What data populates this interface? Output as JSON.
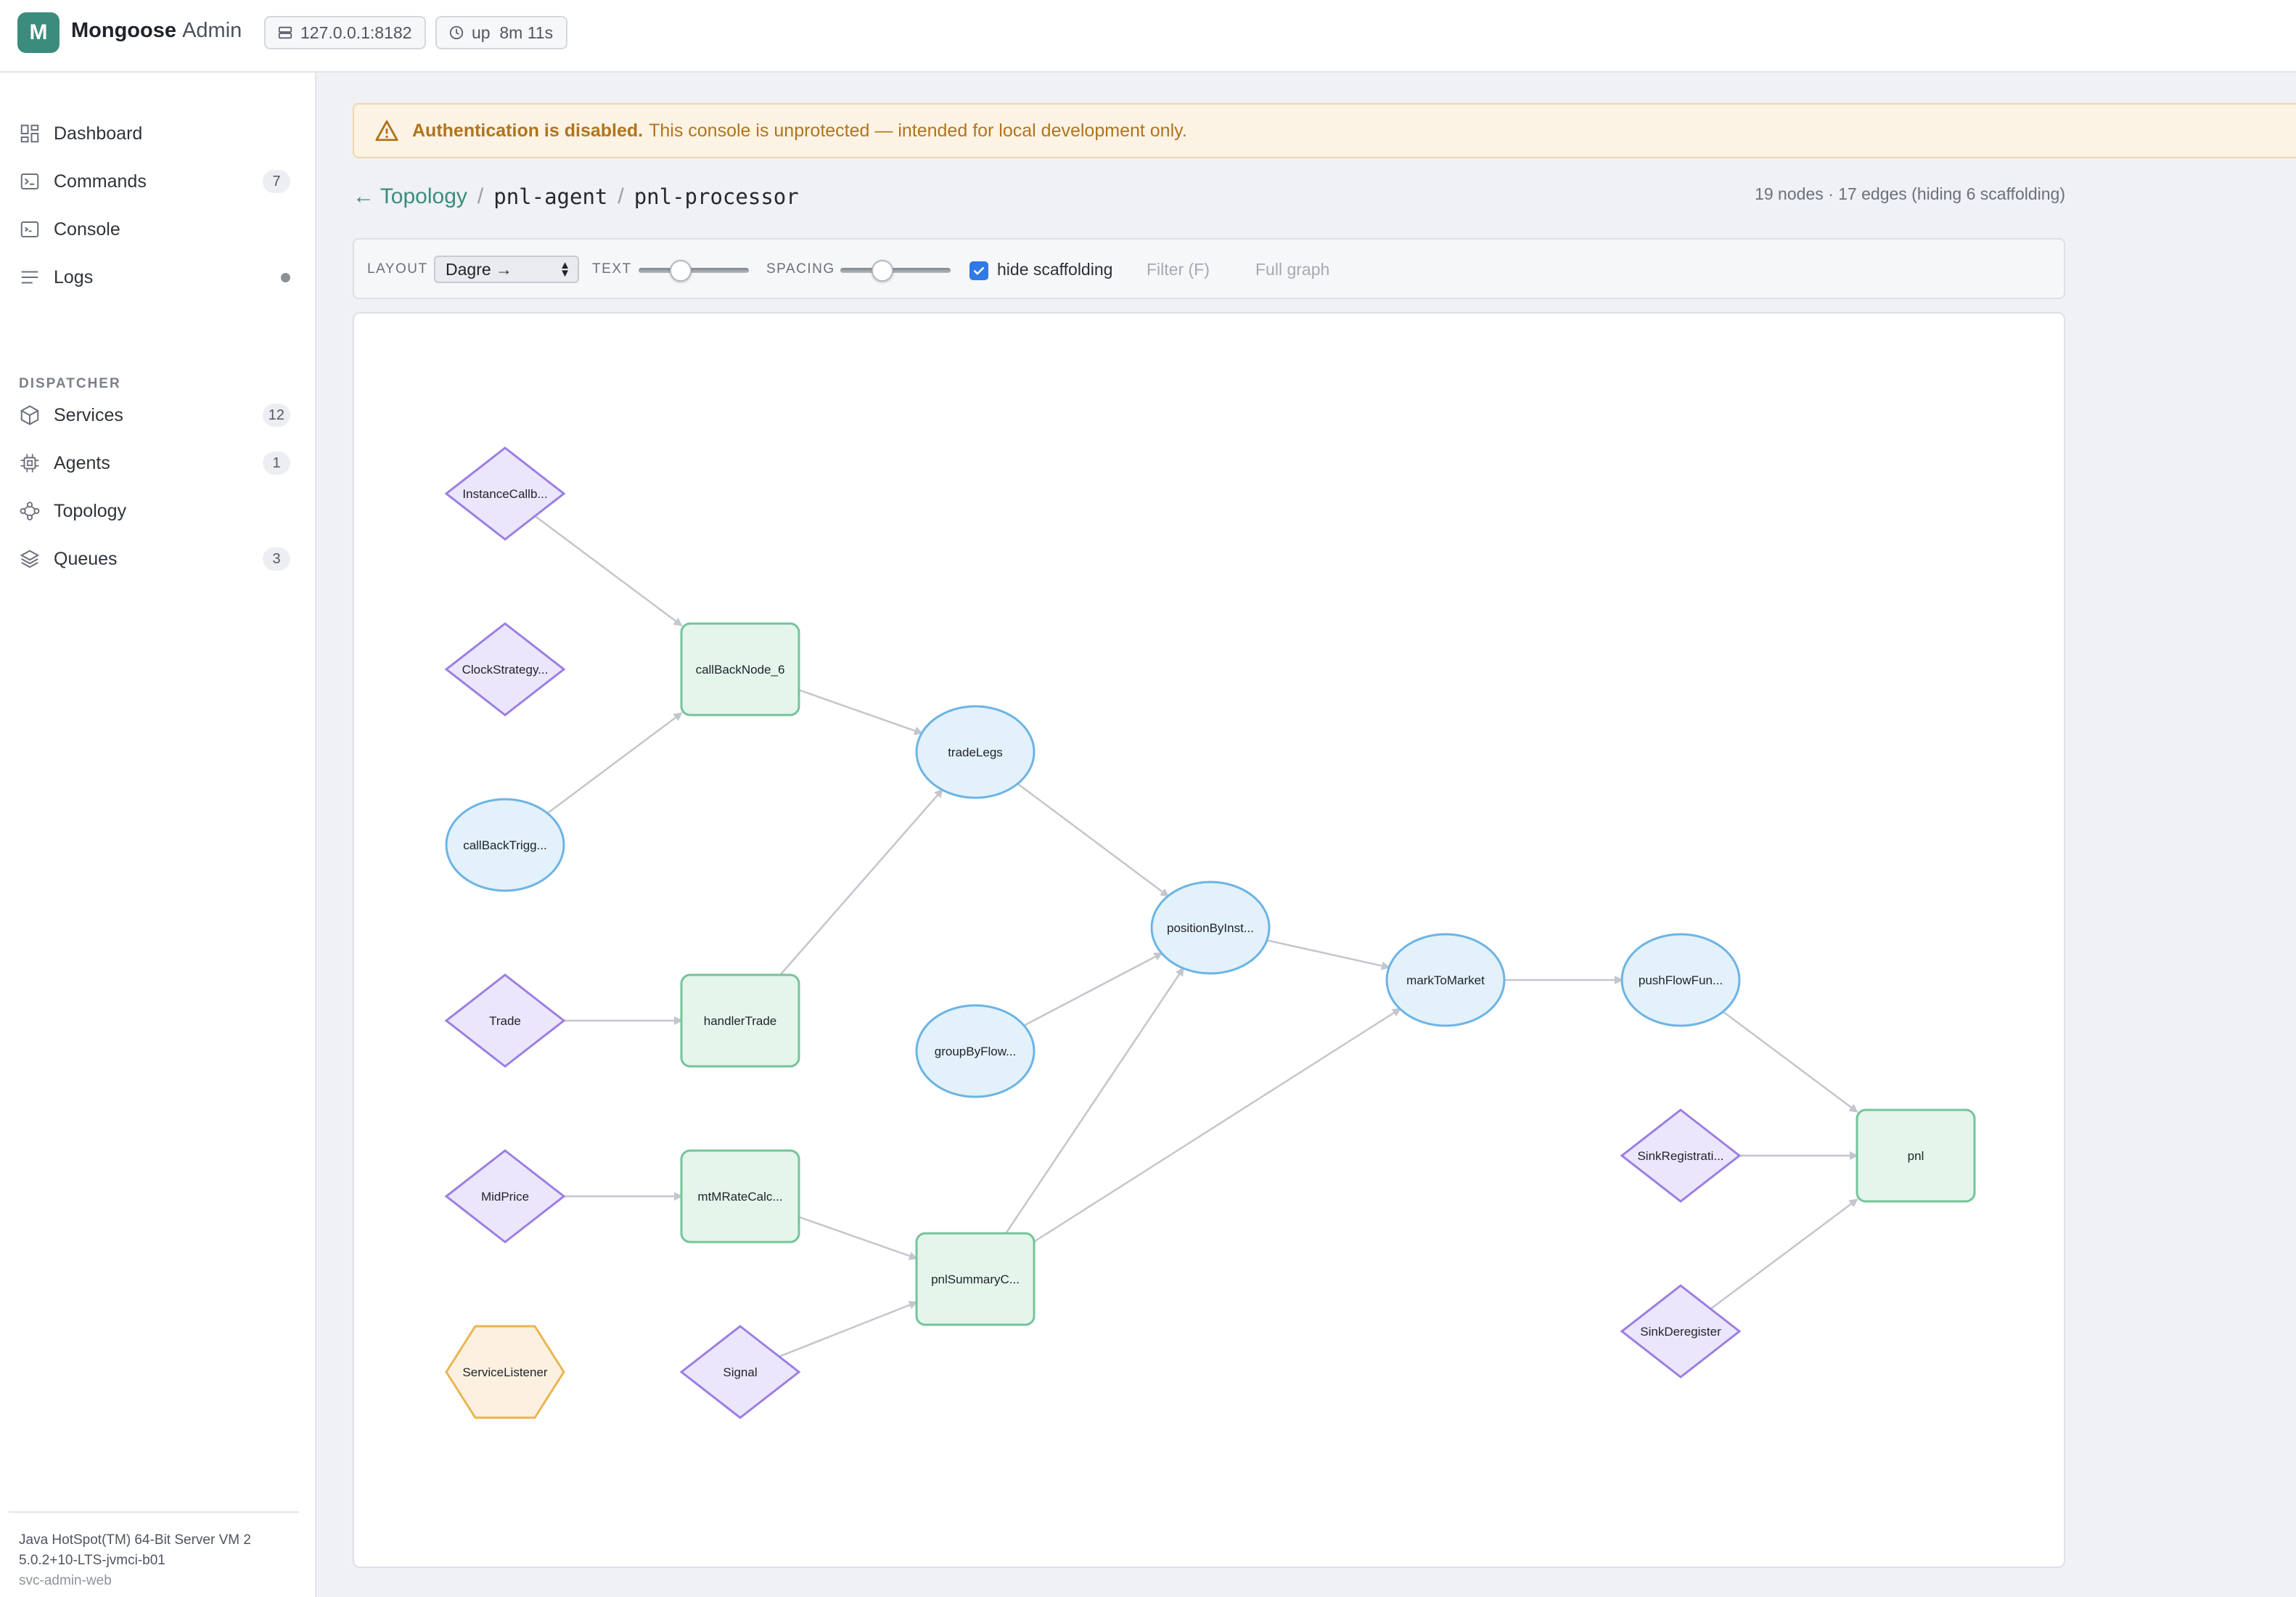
{
  "app": {
    "logo_letter": "M",
    "name": "Mongoose",
    "name_suffix": "Admin"
  },
  "header": {
    "address": "127.0.0.1:8182",
    "uptime": "up  8m 11s"
  },
  "sidebar": {
    "items": [
      {
        "label": "Dashboard",
        "icon": "grid-icon"
      },
      {
        "label": "Commands",
        "icon": "terminal-icon",
        "badge": "7"
      },
      {
        "label": "Console",
        "icon": "console-icon"
      },
      {
        "label": "Logs",
        "icon": "lines-icon",
        "indicator": "dot"
      }
    ],
    "section_label": "DISPATCHER",
    "dispatcher_items": [
      {
        "label": "Services",
        "icon": "cube-icon",
        "badge": "12"
      },
      {
        "label": "Agents",
        "icon": "chip-icon",
        "badge": "1"
      },
      {
        "label": "Topology",
        "icon": "topology-icon"
      },
      {
        "label": "Queues",
        "icon": "layers-icon",
        "badge": "3"
      }
    ],
    "footer": {
      "vm_line1": "Java HotSpot(TM) 64-Bit Server VM 2",
      "vm_line2": "5.0.2+10-LTS-jvmci-b01",
      "host": "svc-admin-web"
    }
  },
  "banner": {
    "bold": "Authentication is disabled.",
    "text": "This console is unprotected — intended for local development only."
  },
  "breadcrumb": {
    "back": "← Topology",
    "agent": "pnl-agent",
    "processor": "pnl-processor"
  },
  "stats": "19 nodes · 17 edges (hiding 6 scaffolding)",
  "toolbar": {
    "layout_label": "LAYOUT",
    "layout_value": "Dagre →",
    "text_label": "TEXT",
    "text_level": 0.35,
    "spacing_label": "SPACING",
    "spacing_level": 0.35,
    "hide_label": "hide scaffolding",
    "hide_checked": true,
    "filter_label": "Filter (F)",
    "full_graph_label": "Full graph"
  },
  "colors": {
    "accent": "#3b8c7c",
    "diamond_fill": "#ece6fc",
    "diamond_stroke": "#9b7fe3",
    "rect_fill": "#e4f5ec",
    "rect_stroke": "#74c49a",
    "ellipse_fill": "#e3f1fb",
    "ellipse_stroke": "#6cb4e4",
    "hex_fill": "#fcf1e0",
    "hex_stroke": "#eab54f",
    "edge": "#c3c6cc"
  },
  "graph": {
    "nodes": [
      {
        "id": "instanceCallb",
        "label": "InstanceCallb...",
        "shape": "diamond"
      },
      {
        "id": "clockStrategy",
        "label": "ClockStrategy...",
        "shape": "diamond"
      },
      {
        "id": "callBackTrigg",
        "label": "callBackTrigg...",
        "shape": "ellipse"
      },
      {
        "id": "trade",
        "label": "Trade",
        "shape": "diamond"
      },
      {
        "id": "midPrice",
        "label": "MidPrice",
        "shape": "diamond"
      },
      {
        "id": "serviceListener",
        "label": "ServiceListener",
        "shape": "hexagon"
      },
      {
        "id": "callBackNode6",
        "label": "callBackNode_6",
        "shape": "rect"
      },
      {
        "id": "handlerTrade",
        "label": "handlerTrade",
        "shape": "rect"
      },
      {
        "id": "mtmRateCalc",
        "label": "mtMRateCalc...",
        "shape": "rect"
      },
      {
        "id": "signal",
        "label": "Signal",
        "shape": "diamond"
      },
      {
        "id": "tradeLegs",
        "label": "tradeLegs",
        "shape": "ellipse"
      },
      {
        "id": "groupByFlow",
        "label": "groupByFlow...",
        "shape": "ellipse"
      },
      {
        "id": "pnlSummaryC",
        "label": "pnlSummaryC...",
        "shape": "rect"
      },
      {
        "id": "positionByInst",
        "label": "positionByInst...",
        "shape": "ellipse"
      },
      {
        "id": "markToMarket",
        "label": "markToMarket",
        "shape": "ellipse"
      },
      {
        "id": "pushFlowFun",
        "label": "pushFlowFun...",
        "shape": "ellipse"
      },
      {
        "id": "sinkRegistrati",
        "label": "SinkRegistrati...",
        "shape": "diamond"
      },
      {
        "id": "sinkDeregister",
        "label": "SinkDeregister",
        "shape": "diamond"
      },
      {
        "id": "pnl",
        "label": "pnl",
        "shape": "rect"
      }
    ],
    "edges": [
      [
        "instanceCallb",
        "callBackNode6"
      ],
      [
        "callBackTrigg",
        "callBackNode6"
      ],
      [
        "callBackNode6",
        "tradeLegs"
      ],
      [
        "trade",
        "handlerTrade"
      ],
      [
        "handlerTrade",
        "tradeLegs"
      ],
      [
        "midPrice",
        "mtmRateCalc"
      ],
      [
        "mtmRateCalc",
        "pnlSummaryC"
      ],
      [
        "signal",
        "pnlSummaryC"
      ],
      [
        "tradeLegs",
        "positionByInst"
      ],
      [
        "groupByFlow",
        "positionByInst"
      ],
      [
        "pnlSummaryC",
        "positionByInst"
      ],
      [
        "pnlSummaryC",
        "markToMarket"
      ],
      [
        "positionByInst",
        "markToMarket"
      ],
      [
        "markToMarket",
        "pushFlowFun"
      ],
      [
        "pushFlowFun",
        "pnl"
      ],
      [
        "sinkRegistrati",
        "pnl"
      ],
      [
        "sinkDeregister",
        "pnl"
      ]
    ]
  }
}
